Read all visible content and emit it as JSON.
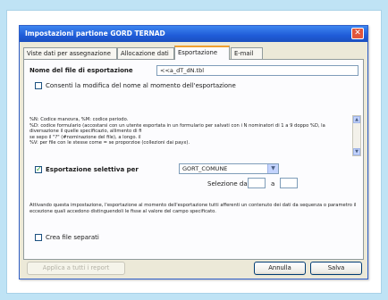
{
  "dialog": {
    "title": "Impostazioni partione GORD TERNAD",
    "close_glyph": "✕"
  },
  "tabs": [
    {
      "label": "Viste dati per assegnazione"
    },
    {
      "label": "Allocazione dati"
    },
    {
      "label": "Esportazione"
    },
    {
      "label": "E-mail"
    }
  ],
  "export": {
    "filename_label": "Nome del file di esportazione",
    "filename_value": "<<a_dT_dN.tbl",
    "consent_label": "Consenti la modifica del nome al momento dell'esportazione",
    "consent_checked": false,
    "notes": [
      "%N: Codice manovra, %M: codice periodo.",
      "%D: codice formulario (accostarsi con un utente esportata in un formulario per salvati con i N nominatori di 1 a 9 doppo %D, la diversazione il quelle specificazio, allimento di fi",
      "se sepo il \"?\" (#nominazione del file), a longo. il",
      "%V: per file con le stesse come = se proporzioe (collezioni dai payx)."
    ],
    "selective_label": "Esportazione selettiva per",
    "selective_checked": true,
    "selective_select_value": "GORT_COMUNE",
    "selection_label": "Selezione da",
    "selection_to_label": "a",
    "selection_from_value": "",
    "selection_to_value": "",
    "selective_desc": "Attivando questa impostazione, l'esportazione al momento dell'esportazione tutti afferenti un contenuto dei dati da sequenza o parametro il eccezione quali accedono distinguendoli le fisse al valore del campo specificato.",
    "create_files_label": "Crea file separati",
    "create_files_checked": false
  },
  "buttons": {
    "apply_all_label": "Applica a tutti i report",
    "cancel_label": "Annulla",
    "save_label": "Salva"
  },
  "colors": {
    "titlebar": "#1f5cd8",
    "dialog_bg": "#ece9d8",
    "active_tab_accent": "#f0a030",
    "background": "#bfe3f5"
  }
}
